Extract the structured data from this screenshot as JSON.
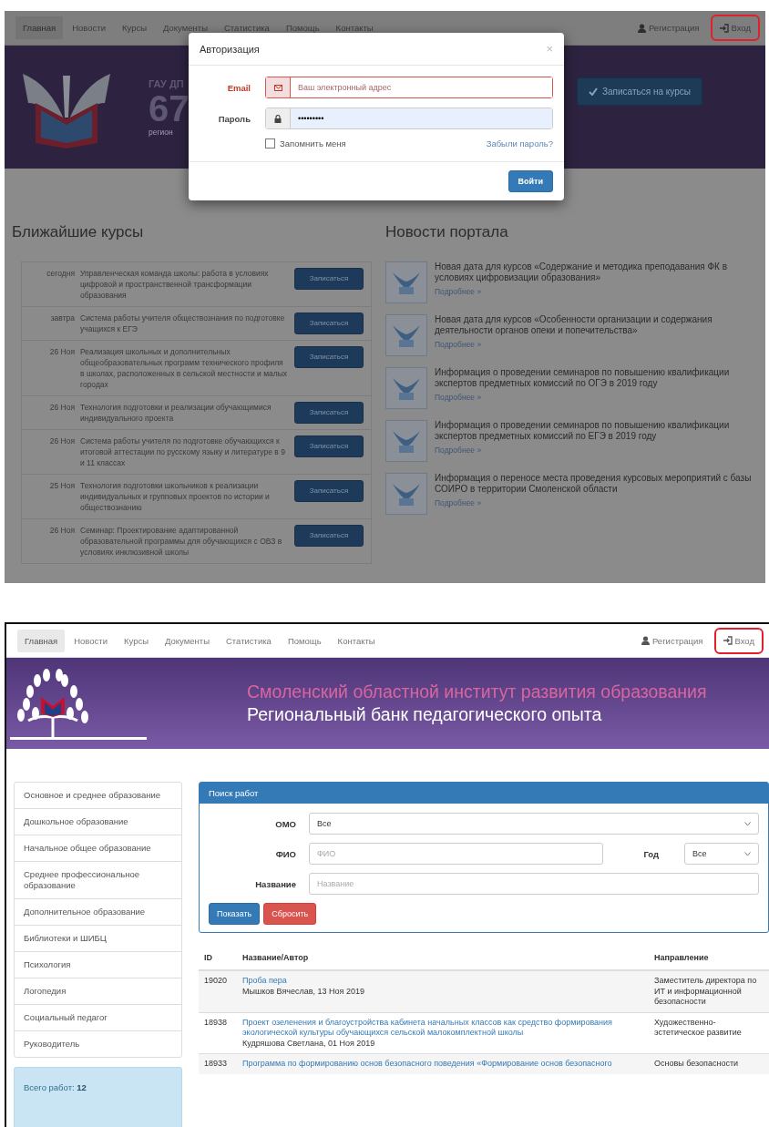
{
  "login_screen": {
    "navbar": {
      "items": [
        {
          "label": "Главная",
          "selected": true
        },
        {
          "label": "Новости",
          "selected": false
        },
        {
          "label": "Курсы",
          "selected": false
        },
        {
          "label": "Документы",
          "selected": false
        },
        {
          "label": "Статистика",
          "selected": false
        },
        {
          "label": "Помощь",
          "selected": false
        },
        {
          "label": "Контакты",
          "selected": false
        }
      ],
      "register": {
        "label": "Регистрация",
        "highlighted": false
      },
      "login": {
        "label": "Вход",
        "highlighted": true
      }
    },
    "banner": {
      "org_text": "ГАУ ДП",
      "number": "67",
      "caption": "регион",
      "signup_button": "Записаться на курсы"
    },
    "modal": {
      "title": "Авторизация",
      "close": "×",
      "email": {
        "label": "Email",
        "placeholder": "Ваш электронный адрес",
        "error": true
      },
      "password": {
        "label": "Пароль",
        "value": "•••••••••",
        "autofilled": true
      },
      "remember": {
        "label": "Запомнить меня",
        "checked": false
      },
      "forgot_link": "Забыли пароль?",
      "submit": "Войти"
    },
    "courses": {
      "title": "Ближайшие курсы",
      "items": [
        {
          "date": "сегодня",
          "title": "Управленческая команда школы: работа в условиях цифровой и пространственной трансформации образования",
          "button": "Записаться"
        },
        {
          "date": "завтра",
          "title": "Система работы учителя обществознания по подготовке учащихся к ЕГЭ",
          "button": "Записаться"
        },
        {
          "date": "26 Ноя",
          "title": "Реализация школьных и дополнительных общеобразовательных программ технического профиля в школах, расположенных в сельской местности и малых городах",
          "button": "Записаться"
        },
        {
          "date": "26 Ноя",
          "title": "Технология подготовки и реализации обучающимися индивидуального проекта",
          "button": "Записаться"
        },
        {
          "date": "26 Ноя",
          "title": "Система работы учителя по подготовке обучающихся к итоговой аттестации по русскому языку и литературе в 9 и 11 классах",
          "button": "Записаться"
        },
        {
          "date": "25 Ноя",
          "title": "Технология подготовки школьников к реализации индивидуальных и групповых проектов по истории и обществознанию",
          "button": "Записаться"
        },
        {
          "date": "26 Ноя",
          "title": "Семинар: Проектирование адаптированной образовательной программы для обучающихся с ОВЗ в условиях инклюзивной школы",
          "button": "Записаться"
        }
      ]
    },
    "news": {
      "title": "Новости портала",
      "items": [
        {
          "title": "Новая дата для курсов «Содержание и методика преподавания ФК в условиях цифровизации образования»",
          "more": "Подробнее »"
        },
        {
          "title": "Новая дата для курсов «Особенности организации и содержания деятельности органов опеки и попечительства»",
          "more": "Подробнее »"
        },
        {
          "title": "Информация о проведении семинаров по повышению квалификации экспертов предметных комиссий по ОГЭ в 2019 году",
          "more": "Подробнее »"
        },
        {
          "title": "Информация о проведении семинаров по повышению квалификации экспертов предметных комиссий по ЕГЭ в 2019 году",
          "more": "Подробнее »"
        },
        {
          "title": "Информация о переносе места проведения курсовых мероприятий с базы СОИРО в территории Смоленской области",
          "more": "Подробнее »"
        }
      ]
    }
  },
  "bank_screen": {
    "navbar": {
      "items": [
        {
          "label": "Главная",
          "selected": true
        },
        {
          "label": "Новости",
          "selected": false
        },
        {
          "label": "Курсы",
          "selected": false
        },
        {
          "label": "Документы",
          "selected": false
        },
        {
          "label": "Статистика",
          "selected": false
        },
        {
          "label": "Помощь",
          "selected": false
        },
        {
          "label": "Контакты",
          "selected": false
        }
      ],
      "register": {
        "label": "Регистрация",
        "highlighted": false
      },
      "login": {
        "label": "Вход",
        "highlighted": true
      }
    },
    "banner": {
      "title": "Смоленский областной институт развития образования",
      "subtitle": "Региональный банк педагогического опыта"
    },
    "sidebar": {
      "items": [
        {
          "label": "Основное и среднее образование"
        },
        {
          "label": "Дошкольное образование"
        },
        {
          "label": "Начальное общее образование"
        },
        {
          "label": "Среднее профессиональное образование"
        },
        {
          "label": "Дополнительное образование"
        },
        {
          "label": "Библиотеки и ШИБЦ"
        },
        {
          "label": "Психология"
        },
        {
          "label": "Логопедия"
        },
        {
          "label": "Социальный педагог"
        },
        {
          "label": "Руководитель"
        }
      ],
      "total": "Всего работ: **12**"
    },
    "search": {
      "title": "Поиск работ",
      "omo": {
        "label": "ОМО",
        "value": "Все"
      },
      "fio": {
        "label": "ФИО",
        "placeholder": "ФИО"
      },
      "year": {
        "label": "Год",
        "value": "Все"
      },
      "name": {
        "label": "Название",
        "placeholder": "Название"
      },
      "show_button": "Показать",
      "reset_button": "Сбросить"
    },
    "table": {
      "columns": [
        "ID",
        "Название/Автор",
        "Направление"
      ],
      "rows": [
        {
          "id": "19020",
          "title": "Проба пера",
          "author": "Мышков Вячеслав, 13 Ноя 2019",
          "direction": "Заместитель директора по ИТ и информационной безопасности"
        },
        {
          "id": "18938",
          "title": "Проект озеленения и благоустройства кабинета начальных классов как средство формирования экологической культуры обучающихся сельской малокомплектной школы",
          "author": "Кудряшова Светлана, 01 Ноя 2019",
          "direction": "Художественно-эстетическое развитие"
        },
        {
          "id": "18933",
          "title": "Программа по формированию основ безопасного поведения «Формирование основ безопасного",
          "direction": "Основы безопасности"
        }
      ]
    }
  }
}
